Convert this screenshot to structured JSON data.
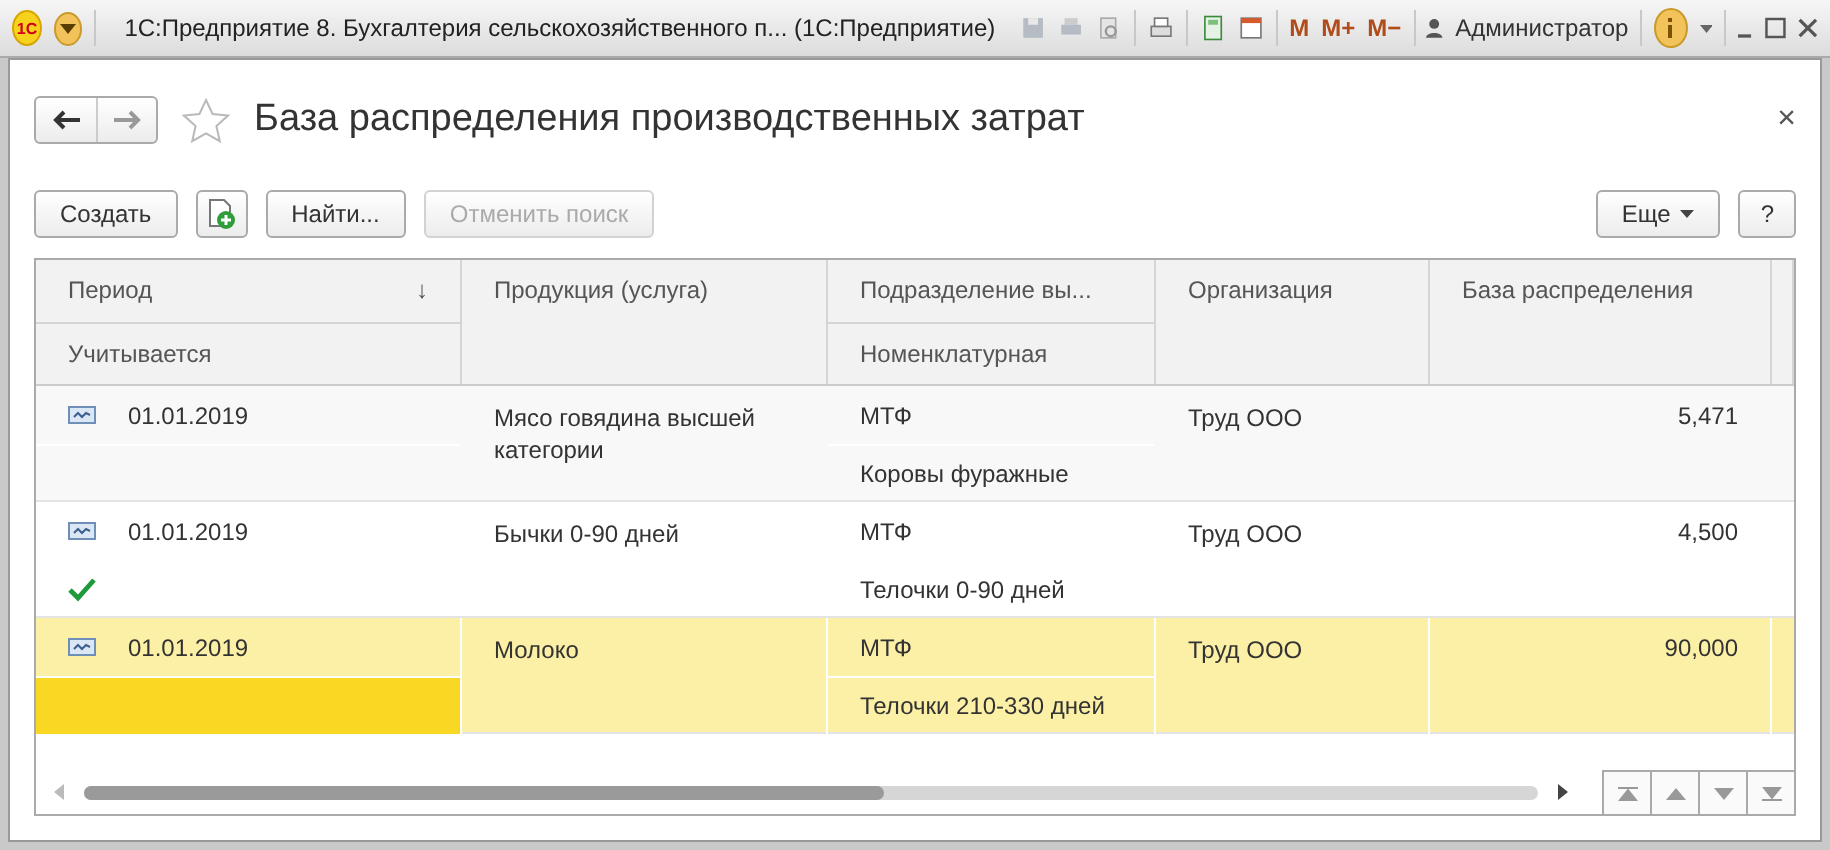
{
  "app_bar": {
    "logo": "1С",
    "title": "1С:Предприятие 8. Бухгалтерия сельскохозяйственного п...  (1С:Предприятие)",
    "memory_buttons": [
      "M",
      "M+",
      "M−"
    ],
    "user": "Администратор"
  },
  "form": {
    "title": "База распределения производственных затрат",
    "favorite": false,
    "close": "×"
  },
  "toolbar": {
    "create": "Создать",
    "find": "Найти...",
    "cancel_search": {
      "label": "Отменить поиск",
      "disabled": true
    },
    "more": "Еще",
    "help": "?"
  },
  "table": {
    "columns": {
      "period": "Период",
      "accounted": "Учитывается",
      "product": "Продукция (услуга)",
      "division": "Подразделение вы...",
      "nomenclature": "Номенклатурная",
      "organization": "Организация",
      "base": "База распределения"
    },
    "sort_mark": "↓",
    "rows": [
      {
        "period": "01.01.2019",
        "accounted": false,
        "product": "Мясо говядина высшей категории",
        "division": "МТФ",
        "nomenclature": "Коровы фуражные",
        "organization": "Труд ООО",
        "base": "5,471",
        "selected": false
      },
      {
        "period": "01.01.2019",
        "accounted": true,
        "product": "Бычки 0-90 дней",
        "division": "МТФ",
        "nomenclature": "Телочки 0-90 дней",
        "organization": "Труд ООО",
        "base": "4,500",
        "selected": false
      },
      {
        "period": "01.01.2019",
        "accounted": false,
        "product": "Молоко",
        "division": "МТФ",
        "nomenclature": "Телочки 210-330 дней",
        "organization": "Труд ООО",
        "base": "90,000",
        "selected": true
      }
    ],
    "scroll": {
      "level": 0.55
    }
  }
}
